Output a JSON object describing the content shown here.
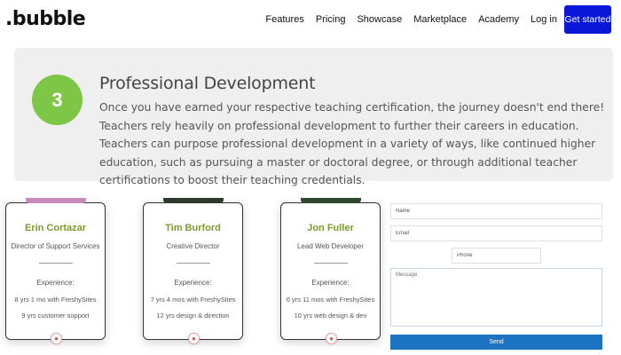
{
  "header": {
    "logo": ".bubble",
    "nav": [
      "Features",
      "Pricing",
      "Showcase",
      "Marketplace",
      "Academy",
      "Log in"
    ],
    "cta": "Get started"
  },
  "hero": {
    "step": "3",
    "title": "Professional Development",
    "body": "Once you have earned your respective teaching certification, the journey doesn't end there! Teachers rely heavily on professional development to further their careers in education. Teachers can purpose professional development in a variety of ways, like continued higher education, such as pursuing a master or doctoral degree, or through additional teacher certifications to boost their teaching credentials."
  },
  "team": [
    {
      "name": "Erin Cortazar",
      "role": "Director of Support Services",
      "exp_label": "Experience:",
      "exp1": "8 yrs 1 mo with FreshySites",
      "exp2": "9 yrs customer support",
      "photo_color": "#c88ab8"
    },
    {
      "name": "Tim Burford",
      "role": "Creative Director",
      "exp_label": "Experience:",
      "exp1": "7 yrs 4 mos with FreshySites",
      "exp2": "12 yrs design & direction",
      "photo_color": "#2b3a2a"
    },
    {
      "name": "Jon Fuller",
      "role": "Lead Web Developer",
      "exp_label": "Experience:",
      "exp1": "6 yrs 11 mos with FreshySites",
      "exp2": "10 yrs web design & dev",
      "photo_color": "#2e4a2e"
    }
  ],
  "form": {
    "name_placeholder": "Name",
    "email_placeholder": "Email",
    "phone_placeholder": "Phone",
    "message_placeholder": "Message",
    "send_label": "Send"
  },
  "colors": {
    "accent": "#0a17d8",
    "badge": "#7ec646",
    "name_green": "#7a9e2b",
    "send_blue": "#1b73c2"
  }
}
